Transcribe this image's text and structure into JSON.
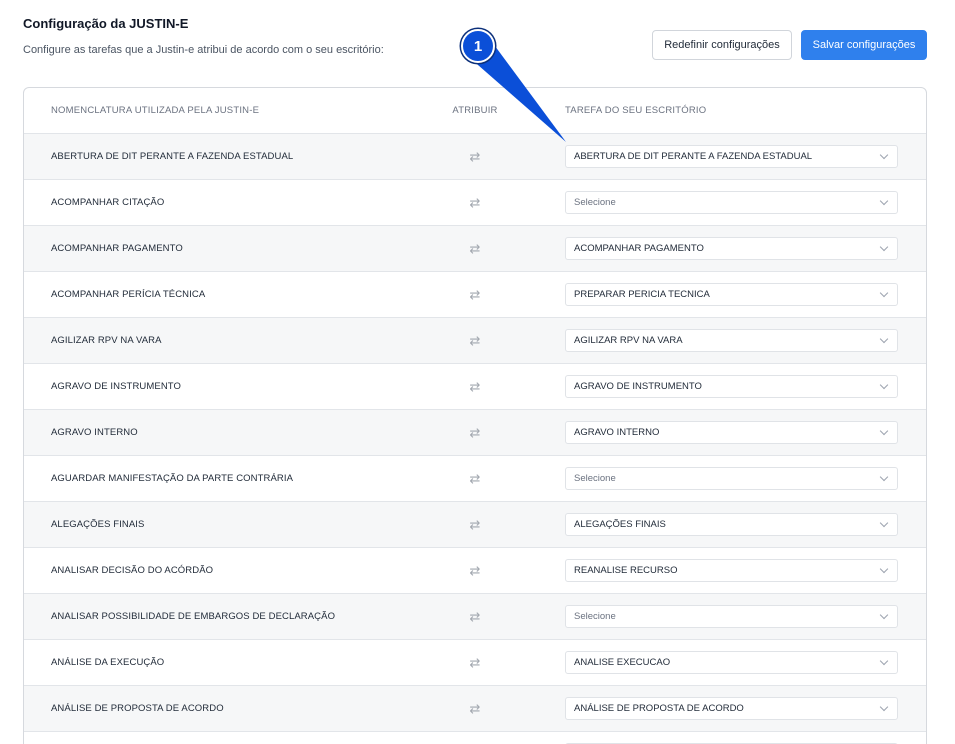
{
  "header": {
    "title": "Configuração da JUSTIN-E",
    "subtitle": "Configure as tarefas que a Justin-e atribui de acordo com o seu escritório:",
    "reset_label": "Redefinir configurações",
    "save_label": "Salvar configurações"
  },
  "table": {
    "columns": [
      "NOMENCLATURA UTILIZADA PELA JUSTIN-E",
      "ATRIBUIR",
      "TAREFA DO SEU ESCRITÓRIO"
    ],
    "assign_icon": "swap-arrows-icon",
    "rows": [
      {
        "name": "ABERTURA DE DIT PERANTE A FAZENDA ESTADUAL",
        "task": "ABERTURA DE DIT PERANTE A FAZENDA ESTADUAL"
      },
      {
        "name": "ACOMPANHAR CITAÇÃO",
        "task": "Selecione"
      },
      {
        "name": "ACOMPANHAR PAGAMENTO",
        "task": "ACOMPANHAR PAGAMENTO"
      },
      {
        "name": "ACOMPANHAR PERÍCIA TÉCNICA",
        "task": "PREPARAR PERICIA TECNICA"
      },
      {
        "name": "AGILIZAR RPV NA VARA",
        "task": "AGILIZAR RPV NA VARA"
      },
      {
        "name": "AGRAVO DE INSTRUMENTO",
        "task": "AGRAVO DE INSTRUMENTO"
      },
      {
        "name": "AGRAVO INTERNO",
        "task": "AGRAVO INTERNO"
      },
      {
        "name": "AGUARDAR MANIFESTAÇÃO DA PARTE CONTRÁRIA",
        "task": "Selecione"
      },
      {
        "name": "ALEGAÇÕES FINAIS",
        "task": "ALEGAÇÕES FINAIS"
      },
      {
        "name": "ANALISAR DECISÃO DO ACÓRDÃO",
        "task": "REANALISE RECURSO"
      },
      {
        "name": "ANALISAR POSSIBILIDADE DE EMBARGOS DE DECLARAÇÃO",
        "task": "Selecione"
      },
      {
        "name": "ANÁLISE DA EXECUÇÃO",
        "task": "ANALISE EXECUCAO"
      },
      {
        "name": "ANÁLISE DE PROPOSTA DE ACORDO",
        "task": "ANÁLISE DE PROPOSTA DE ACORDO"
      },
      {
        "name": "",
        "task": ""
      }
    ]
  },
  "callout": {
    "number": "1",
    "color": "#0b4fd8"
  }
}
